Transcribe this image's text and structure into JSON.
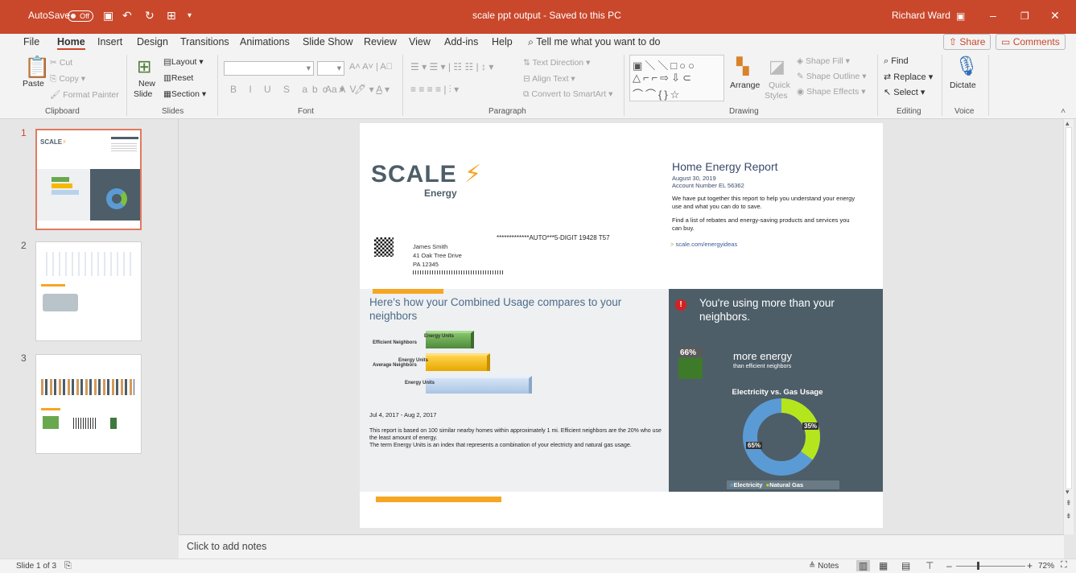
{
  "titlebar": {
    "autosave_label": "AutoSave",
    "autosave_state": "Off",
    "doc_title": "scale ppt output  -  Saved to this PC",
    "user": "Richard Ward"
  },
  "tabs": [
    "File",
    "Home",
    "Insert",
    "Design",
    "Transitions",
    "Animations",
    "Slide Show",
    "Review",
    "View",
    "Add-ins",
    "Help"
  ],
  "tell_me": "Tell me what you want to do",
  "share_label": "Share",
  "comments_label": "Comments",
  "ribbon": {
    "clipboard": {
      "paste": "Paste",
      "cut": "Cut",
      "copy": "Copy",
      "format_painter": "Format Painter",
      "group": "Clipboard"
    },
    "slides": {
      "new_slide_1": "New",
      "new_slide_2": "Slide",
      "layout": "Layout",
      "reset": "Reset",
      "section": "Section",
      "group": "Slides"
    },
    "font": {
      "group": "Font",
      "case_label": "Aa"
    },
    "paragraph": {
      "text_direction": "Text Direction",
      "align_text": "Align Text",
      "smartart": "Convert to SmartArt",
      "group": "Paragraph"
    },
    "drawing": {
      "arrange": "Arrange",
      "quick_styles_1": "Quick",
      "quick_styles_2": "Styles",
      "shape_fill": "Shape Fill",
      "shape_outline": "Shape Outline",
      "shape_effects": "Shape Effects",
      "group": "Drawing"
    },
    "editing": {
      "find": "Find",
      "replace": "Replace",
      "select": "Select",
      "group": "Editing"
    },
    "voice": {
      "dictate": "Dictate",
      "group": "Voice"
    }
  },
  "thumbnails": [
    {
      "num": "1"
    },
    {
      "num": "2"
    },
    {
      "num": "3"
    }
  ],
  "slide": {
    "logo_main": "SCALE",
    "logo_sub": "Energy",
    "report_title": "Home Energy Report",
    "report_date": "August 30, 2019",
    "account": "Account Number EL 56362",
    "intro_1": "We have put together this report to help you understand your energy use and what you can do to save.",
    "intro_2": "Find a list of rebates and energy-saving products and services you can buy.",
    "link": "scale.com/energyideas",
    "barcode_text": "*************AUTO***5-DIGIT 19428 T57",
    "name": "James Smith",
    "addr1": "41 Oak Tree Drive",
    "addr2": "PA 12345",
    "compare_title": "Here's how your Combined Usage compares to your neighbors",
    "bar_efficient": "Efficient Neighbors",
    "bar_average": "Average Neighbors",
    "bar_value_label": "Energy Units",
    "period": "Jul 4, 2017 - Aug 2, 2017",
    "foot_1": "This report is based on 100 similar nearby homes within approximately 1 mi. Efficient neighbors are the 20% who use the least amount of energy.",
    "foot_2": "The term Energy Units is an index that represents a combination of your electricty and natural gas usage.",
    "alert_title": "You're using more than your neighbors.",
    "pct": "66%",
    "more_energy": "more energy",
    "than_eff": "than efficient neighbors",
    "donut_title": "Electricity vs. Gas Usage",
    "donut_elec": "65%",
    "donut_gas": "35%",
    "legend_elec": "Electricity",
    "legend_gas": "Natural Gas"
  },
  "notes_placeholder": "Click to add notes",
  "status": {
    "slide": "Slide 1 of 3",
    "notes": "Notes",
    "zoom": "72%"
  },
  "colors": {
    "accent": "#c9482c",
    "slate": "#4d5e68",
    "orange": "#f5a623",
    "green": "#7cc242",
    "blue": "#5b9bd5"
  }
}
